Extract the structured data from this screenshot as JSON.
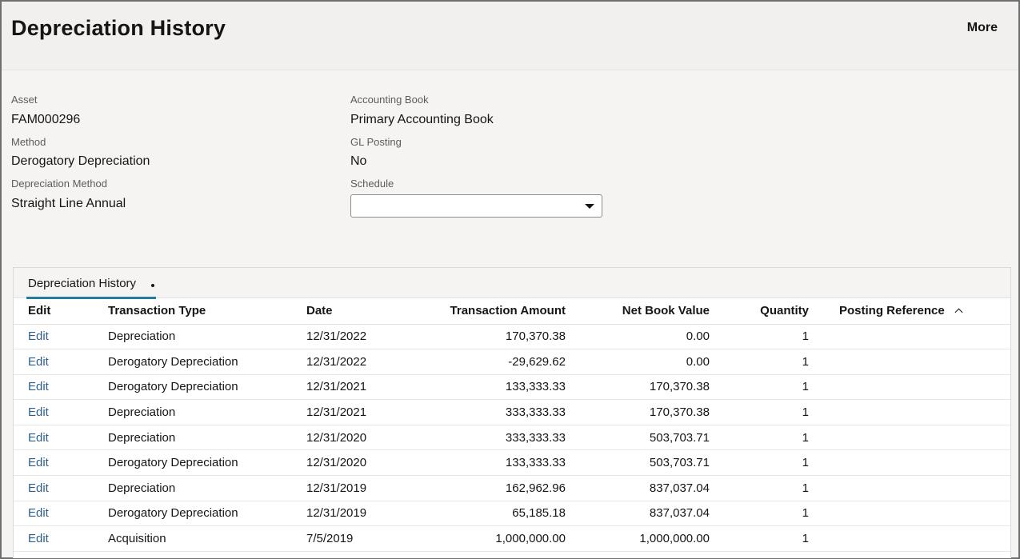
{
  "header": {
    "title": "Depreciation History",
    "more_label": "More"
  },
  "details": {
    "asset": {
      "label": "Asset",
      "value": "FAM000296"
    },
    "method": {
      "label": "Method",
      "value": "Derogatory Depreciation"
    },
    "depreciation_method": {
      "label": "Depreciation Method",
      "value": "Straight Line Annual"
    },
    "accounting_book": {
      "label": "Accounting Book",
      "value": "Primary Accounting Book"
    },
    "gl_posting": {
      "label": "GL Posting",
      "value": "No"
    },
    "schedule": {
      "label": "Schedule",
      "value": ""
    }
  },
  "tab": {
    "label": "Depreciation History",
    "accent_color": "#227e9e"
  },
  "table": {
    "columns": [
      "Edit",
      "Transaction Type",
      "Date",
      "Transaction Amount",
      "Net Book Value",
      "Quantity",
      "Posting Reference"
    ],
    "sort_icon": "chevron-up-icon",
    "rows": [
      {
        "edit": "Edit",
        "type": "Depreciation",
        "date": "12/31/2022",
        "amount": "170,370.38",
        "nbv": "0.00",
        "qty": "1",
        "posting": ""
      },
      {
        "edit": "Edit",
        "type": "Derogatory Depreciation",
        "date": "12/31/2022",
        "amount": "-29,629.62",
        "nbv": "0.00",
        "qty": "1",
        "posting": ""
      },
      {
        "edit": "Edit",
        "type": "Derogatory Depreciation",
        "date": "12/31/2021",
        "amount": "133,333.33",
        "nbv": "170,370.38",
        "qty": "1",
        "posting": ""
      },
      {
        "edit": "Edit",
        "type": "Depreciation",
        "date": "12/31/2021",
        "amount": "333,333.33",
        "nbv": "170,370.38",
        "qty": "1",
        "posting": ""
      },
      {
        "edit": "Edit",
        "type": "Depreciation",
        "date": "12/31/2020",
        "amount": "333,333.33",
        "nbv": "503,703.71",
        "qty": "1",
        "posting": ""
      },
      {
        "edit": "Edit",
        "type": "Derogatory Depreciation",
        "date": "12/31/2020",
        "amount": "133,333.33",
        "nbv": "503,703.71",
        "qty": "1",
        "posting": ""
      },
      {
        "edit": "Edit",
        "type": "Depreciation",
        "date": "12/31/2019",
        "amount": "162,962.96",
        "nbv": "837,037.04",
        "qty": "1",
        "posting": ""
      },
      {
        "edit": "Edit",
        "type": "Derogatory Depreciation",
        "date": "12/31/2019",
        "amount": "65,185.18",
        "nbv": "837,037.04",
        "qty": "1",
        "posting": ""
      },
      {
        "edit": "Edit",
        "type": "Acquisition",
        "date": "7/5/2019",
        "amount": "1,000,000.00",
        "nbv": "1,000,000.00",
        "qty": "1",
        "posting": ""
      }
    ]
  }
}
